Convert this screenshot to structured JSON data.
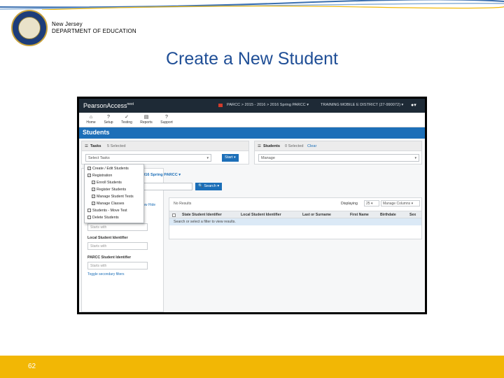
{
  "header": {
    "state": "New Jersey",
    "department": "DEPARTMENT OF EDUCATION",
    "seal_icon": "nj-seal"
  },
  "slide": {
    "title": "Create a New Student",
    "page_number": "62"
  },
  "colors": {
    "title": "#1f4e96",
    "footer": "#f2b705",
    "app_header": "#1e2a36",
    "app_blue": "#1c6fb8"
  },
  "app": {
    "logo": "PearsonAccess",
    "logo_sup": "next",
    "breadcrumb": "PARCC > 2015 - 2016 > 2016 Spring PARCC ▾",
    "organization": "TRAINING MOBILE E DISTRICT (27-990072) ▾",
    "user_icon": "user-icon",
    "nav": [
      {
        "icon": "home-icon",
        "glyph": "⌂",
        "label": "Home"
      },
      {
        "icon": "setup-icon",
        "glyph": "?",
        "label": "Setup"
      },
      {
        "icon": "testing-icon",
        "glyph": "✓",
        "label": "Testing"
      },
      {
        "icon": "reports-icon",
        "glyph": "▤",
        "label": "Reports"
      },
      {
        "icon": "support-icon",
        "glyph": "?",
        "label": "Support"
      }
    ],
    "page_heading": "Students",
    "tasks": {
      "title": "Tasks",
      "count": "5 Selected",
      "select_placeholder": "Select Tasks",
      "start_label": "Start"
    },
    "students": {
      "title": "Students",
      "count": "0 Selected",
      "clear_label": "Clear",
      "manage_label": "Manage"
    },
    "admin_label": "2016 Spring PARCC ▾",
    "search_label": "Search",
    "filter_links": "Show  Hide",
    "dropdown_items": [
      {
        "label": "Create / Edit Students",
        "checked": true
      },
      {
        "label": "Registration",
        "checked": true
      },
      {
        "label": "Enroll Students",
        "checked": true
      },
      {
        "label": "Register Students",
        "checked": true
      },
      {
        "label": "Manage Student Tests",
        "checked": true
      },
      {
        "label": "Manage Classes",
        "checked": true
      },
      {
        "label": "Students - Move Test",
        "checked": false
      },
      {
        "label": "Delete Students",
        "checked": false
      }
    ],
    "filters": [
      {
        "label": "",
        "placeholder": "Starts with"
      },
      {
        "label": "Local Student Identifier",
        "placeholder": "Starts with"
      },
      {
        "label": "PARCC Student Identifier",
        "placeholder": "Starts with"
      }
    ],
    "toggle_filters": "Toggle secondary filters",
    "results": {
      "no_results": "No Results",
      "displaying_label": "Displaying",
      "displaying_value": "25",
      "manage_columns": "Manage Columns",
      "columns": [
        "State Student Identifier",
        "Local Student Identifier",
        "Last or Surname",
        "First Name",
        "Birthdate",
        "Sex"
      ],
      "info": "Search or select a filter to view results."
    }
  }
}
